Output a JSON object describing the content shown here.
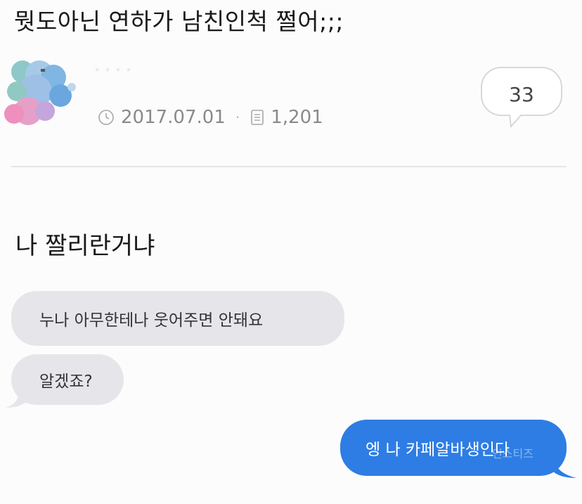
{
  "post": {
    "title": "뭣도아닌 연하가 남친인척 쩔어;;;",
    "author": "· · · ·",
    "date": "2017.07.01",
    "views": "1,201",
    "comment_count": "33",
    "body": "나 짤리란거냐"
  },
  "messages": {
    "incoming_1": "누나 아무한테나 웃어주면 안돼요",
    "incoming_2": "알겠죠?",
    "outgoing_1": "엥 나 카페알바생인다"
  },
  "watermark": "인스티즈",
  "colors": {
    "outgoing_bubble": "#2e7de4",
    "incoming_bubble": "#e6e6ea",
    "meta_text": "#8a8a8a"
  },
  "icons": {
    "date": "clock-icon",
    "views": "document-icon",
    "comments": "speech-bubble-icon"
  }
}
